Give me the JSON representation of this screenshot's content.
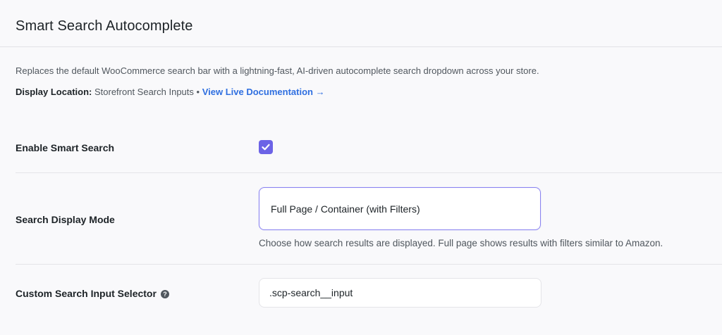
{
  "header": {
    "title": "Smart Search Autocomplete"
  },
  "intro": {
    "description": "Replaces the default WooCommerce search bar with a lightning-fast, AI-driven autocomplete search dropdown across your store.",
    "location_label": "Display Location:",
    "location_value": "Storefront Search Inputs",
    "separator": "•",
    "doc_link": "View Live Documentation →"
  },
  "settings": {
    "enable": {
      "label": "Enable Smart Search",
      "checked": true
    },
    "display_mode": {
      "label": "Search Display Mode",
      "selected": "Full Page / Container (with Filters)",
      "help": "Choose how search results are displayed. Full page shows results with filters similar to Amazon."
    },
    "selector": {
      "label": "Custom Search Input Selector",
      "value": ".scp-search__input"
    }
  },
  "colors": {
    "accent": "#6c63e6",
    "link": "#2f6fe0"
  },
  "icons": {
    "checkbox": "checkmark-icon",
    "help": "question-circle-icon"
  }
}
